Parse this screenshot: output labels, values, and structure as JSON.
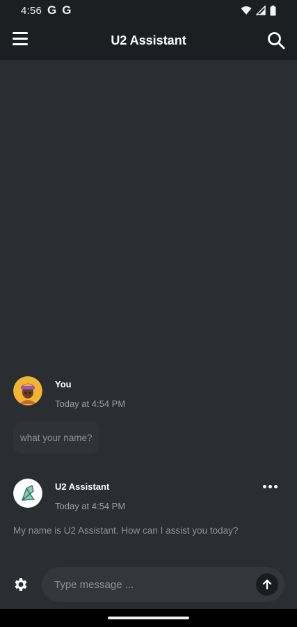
{
  "status_bar": {
    "time": "4:56",
    "notification_icons": [
      "G",
      "G"
    ],
    "wifi_icon": "wifi-icon",
    "signal_icon": "signal-icon",
    "battery_icon": "battery-icon"
  },
  "app_bar": {
    "title": "U2 Assistant",
    "menu_icon": "menu-icon",
    "search_icon": "search-icon"
  },
  "messages": [
    {
      "sender": "You",
      "timestamp": "Today at 4:54 PM",
      "text": "what your name?"
    },
    {
      "sender": "U2 Assistant",
      "timestamp": "Today at 4:54 PM",
      "text": "My name is U2 Assistant. How can I assist you today?"
    }
  ],
  "composer": {
    "placeholder": "Type message ...",
    "settings_icon": "gear-icon",
    "send_icon": "arrow-up-icon"
  },
  "colors": {
    "background": "#2a2d31",
    "bar": "#1c1f22",
    "input": "#33363a",
    "muted_text": "#8e9196"
  }
}
